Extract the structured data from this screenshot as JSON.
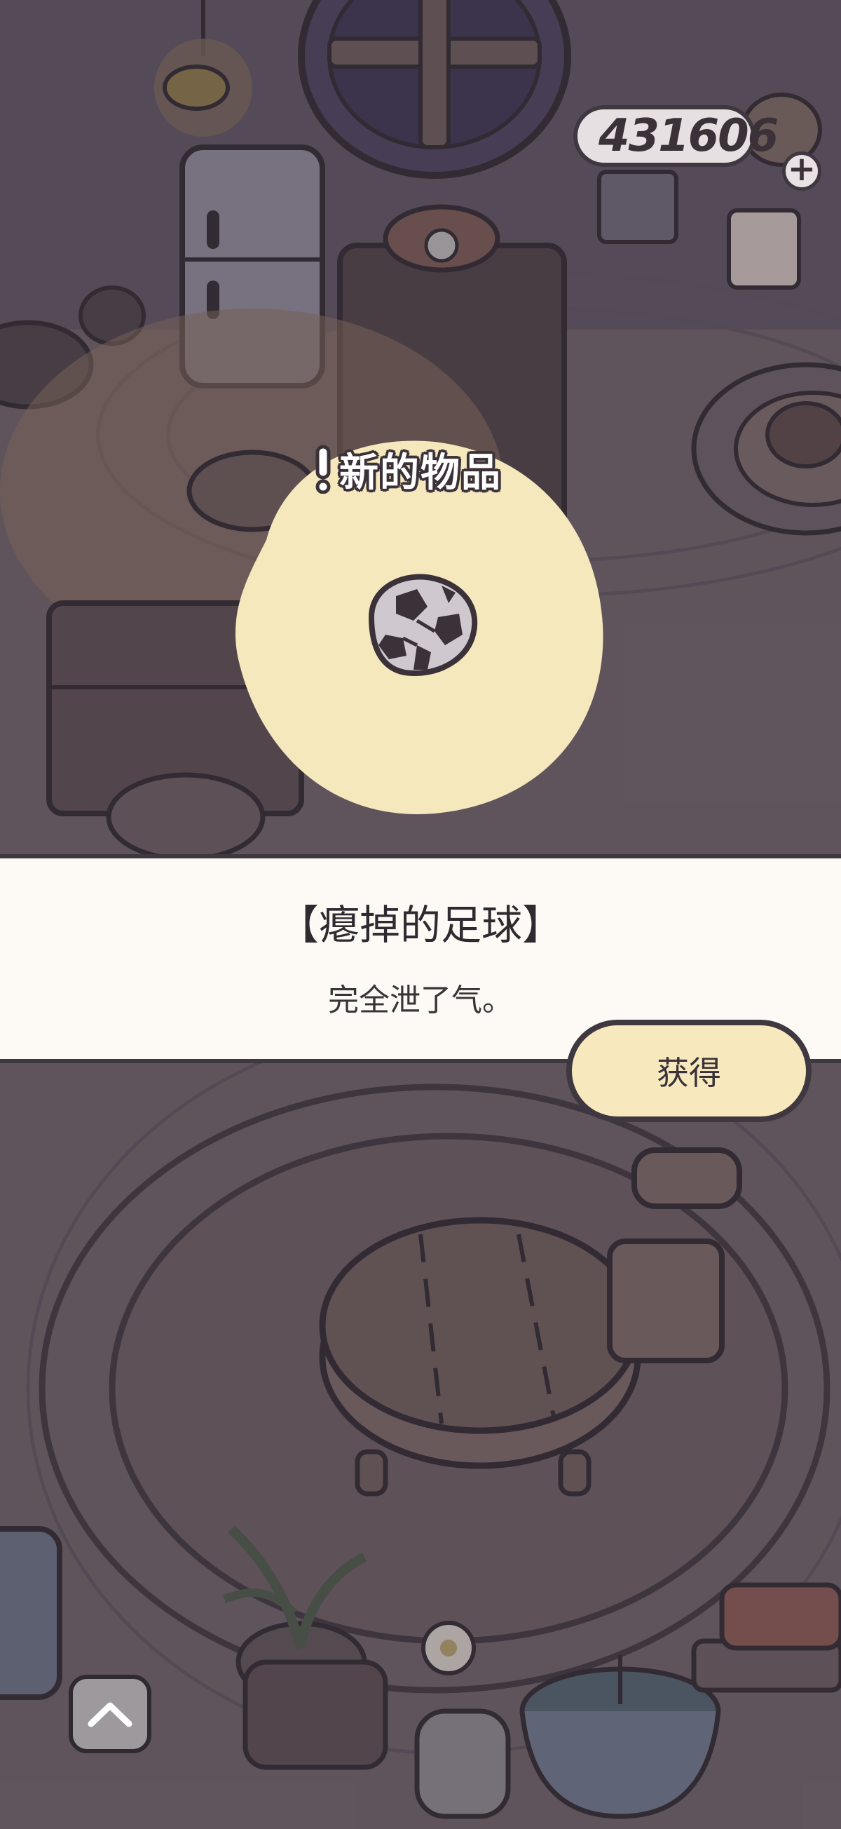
{
  "hud": {
    "coins": "431606",
    "plus_symbol": "+"
  },
  "popup": {
    "header": "新的物品",
    "item_name": "【瘪掉的足球】",
    "item_description": "完全泄了气。",
    "obtain_button_label": "获得",
    "item_icon": "deflated-soccer-ball-icon"
  },
  "controls": {
    "expand_icon": "chevron-up-icon"
  },
  "colors": {
    "spotlight": "#f6e8bd",
    "panel_background": "#fdfaf5",
    "button_background": "#f7e8be",
    "outline": "#3f3840",
    "scene_dim": "#6e6369"
  }
}
